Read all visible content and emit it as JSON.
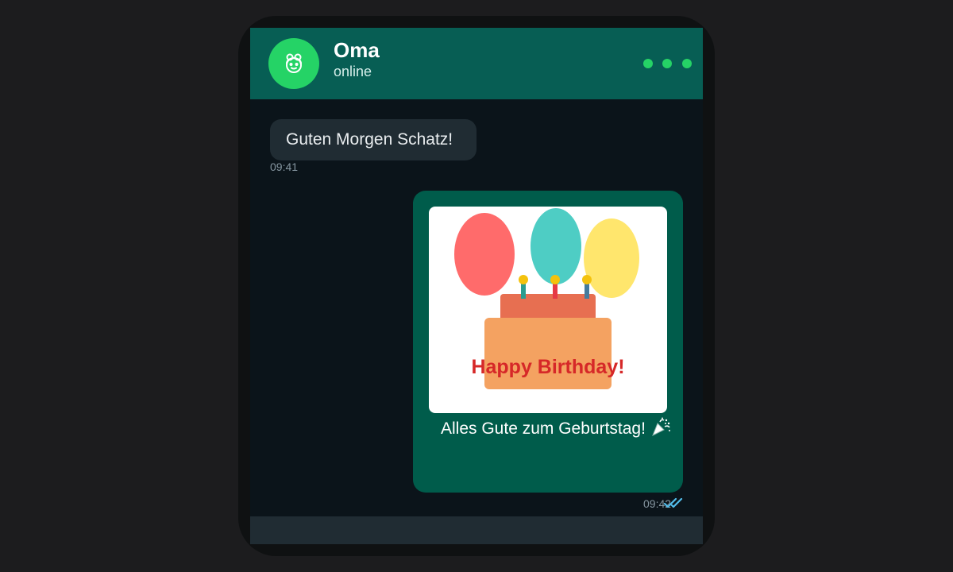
{
  "header": {
    "contact_name": "Oma",
    "contact_status": "online",
    "avatar_icon": "grandmother-face-icon",
    "menu_icon": "more-options-icon",
    "accent_color": "#25d366",
    "bar_color": "#075e54"
  },
  "messages": [
    {
      "direction": "incoming",
      "text": "Guten Morgen Schatz!",
      "time": "09:41"
    },
    {
      "direction": "outgoing",
      "image": {
        "subject": "birthday-cake-with-balloons",
        "text": "Happy Birthday!"
      },
      "caption": "Alles Gute zum Geburtstag!",
      "caption_icon": "party-popper-icon",
      "time": "09:42",
      "status": "read",
      "status_icon": "double-check-icon",
      "status_color": "#53bdeb"
    }
  ],
  "colors": {
    "background": "#0b141a",
    "incoming_bubble": "#202c33",
    "outgoing_bubble": "#005c4b"
  }
}
